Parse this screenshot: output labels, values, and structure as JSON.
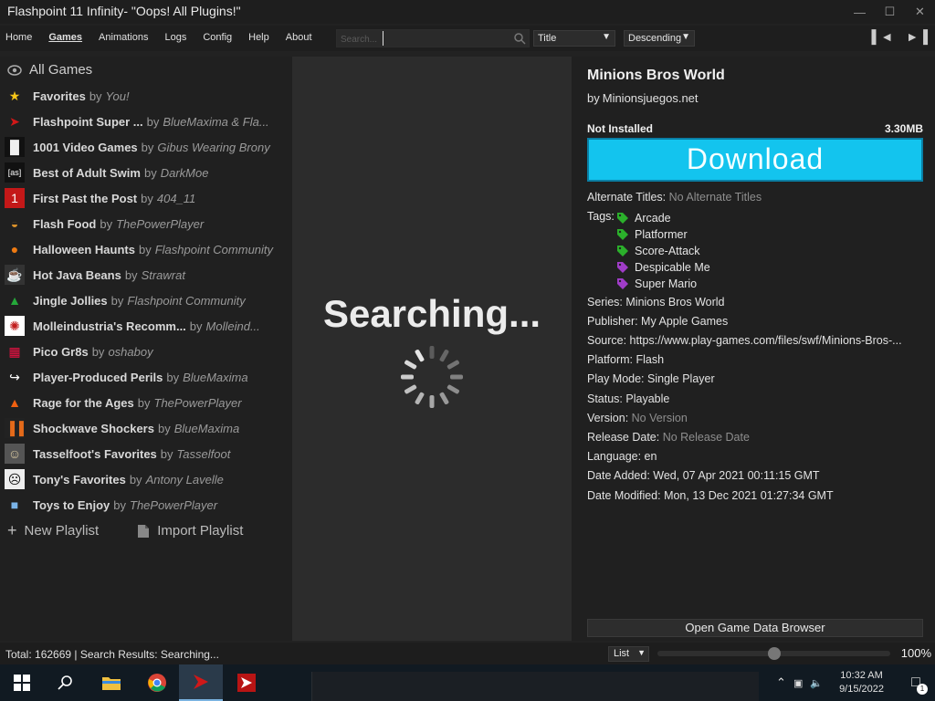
{
  "window": {
    "title": "Flashpoint 11 Infinity- \"Oops! All Plugins!\"",
    "controls": [
      "minimize",
      "maximize",
      "close"
    ]
  },
  "menu": {
    "items": [
      "Home",
      "Games",
      "Animations",
      "Logs",
      "Config",
      "Help",
      "About"
    ],
    "active": "Games"
  },
  "toolbar": {
    "search_placeholder": "Search...",
    "search_value": "",
    "order_by": "Title",
    "order_direction": "Descending"
  },
  "sidebar": {
    "all_games": "All Games",
    "by_label": "by",
    "playlists": [
      {
        "name": "Favorites",
        "author": "You!",
        "icon": "star-icon"
      },
      {
        "name": "Flashpoint Super ...",
        "author": "BlueMaxima & Fla...",
        "icon": "flashpoint-icon"
      },
      {
        "name": "1001 Video Games",
        "author": "Gibus Wearing Brony",
        "icon": "space-invader-icon"
      },
      {
        "name": "Best of Adult Swim",
        "author": "DarkMoe",
        "icon": "adult-swim-icon"
      },
      {
        "name": "First Past the Post",
        "author": "404_11",
        "icon": "number-one-icon"
      },
      {
        "name": "Flash Food",
        "author": "ThePowerPlayer",
        "icon": "burger-icon"
      },
      {
        "name": "Halloween Haunts",
        "author": "Flashpoint Community",
        "icon": "pumpkin-icon"
      },
      {
        "name": "Hot Java Beans",
        "author": "Strawrat",
        "icon": "coffee-icon"
      },
      {
        "name": "Jingle Jollies",
        "author": "Flashpoint Community",
        "icon": "christmas-tree-icon"
      },
      {
        "name": "Molleindustria's Recomm...",
        "author": "Molleind...",
        "icon": "molleindustria-icon"
      },
      {
        "name": "Pico Gr8s",
        "author": "oshaboy",
        "icon": "pico-icon"
      },
      {
        "name": "Player-Produced Perils",
        "author": "BlueMaxima",
        "icon": "share-arrow-icon"
      },
      {
        "name": "Rage for the Ages",
        "author": "ThePowerPlayer",
        "icon": "fire-icon"
      },
      {
        "name": "Shockwave Shockers",
        "author": "BlueMaxima",
        "icon": "shockwave-icon"
      },
      {
        "name": "Tasselfoot's Favorites",
        "author": "Tasselfoot",
        "icon": "tasselfoot-icon"
      },
      {
        "name": "Tony's Favorites",
        "author": "Antony Lavelle",
        "icon": "silhouette-icon"
      },
      {
        "name": "Toys to Enjoy",
        "author": "ThePowerPlayer",
        "icon": "toy-blocks-icon"
      }
    ],
    "new_playlist": "New Playlist",
    "import_playlist": "Import Playlist"
  },
  "center": {
    "status": "Searching..."
  },
  "game": {
    "title": "Minions Bros World",
    "by_label": "by",
    "developer": "Minionsjuegos.net",
    "install_status": "Not Installed",
    "size": "3.30MB",
    "download_label": "Download",
    "alt_titles_label": "Alternate Titles:",
    "alt_titles_value": "No Alternate Titles",
    "tags_label": "Tags:",
    "tags": [
      {
        "name": "Arcade",
        "color": "#2bb02b"
      },
      {
        "name": "Platformer",
        "color": "#2bb02b"
      },
      {
        "name": "Score-Attack",
        "color": "#2bb02b"
      },
      {
        "name": "Despicable Me",
        "color": "#a03cc8"
      },
      {
        "name": "Super Mario",
        "color": "#a03cc8"
      }
    ],
    "series": "Series: Minions Bros World",
    "publisher": "Publisher: My Apple Games",
    "source": "Source: https://www.play-games.com/files/swf/Minions-Bros-...",
    "platform": "Platform: Flash",
    "play_mode": "Play Mode: Single Player",
    "game_status": "Status: Playable",
    "version_label": "Version:",
    "version_value": "No Version",
    "release_label": "Release Date:",
    "release_value": "No Release Date",
    "language": "Language: en",
    "date_added": "Date Added:  Wed, 07 Apr 2021 00:11:15 GMT",
    "date_modified": "Date Modified:  Mon, 13 Dec 2021 01:27:34 GMT",
    "open_browser": "Open Game Data Browser"
  },
  "statusbar": {
    "text": "Total: 162669  |  Search Results: Searching...",
    "view_mode": "List",
    "zoom_level": 0.5,
    "zoom": "100%"
  },
  "taskbar": {
    "apps": [
      "windows-start-icon",
      "search-icon",
      "file-explorer-icon",
      "chrome-icon",
      "flashpoint-icon",
      "flashpoint-launcher-icon"
    ],
    "time": "10:32 AM",
    "date": "9/15/2022",
    "notification_count": "1"
  },
  "colors": {
    "download_bg": "#13c4ee",
    "tag_green": "#2bb02b",
    "tag_purple": "#a03cc8"
  }
}
